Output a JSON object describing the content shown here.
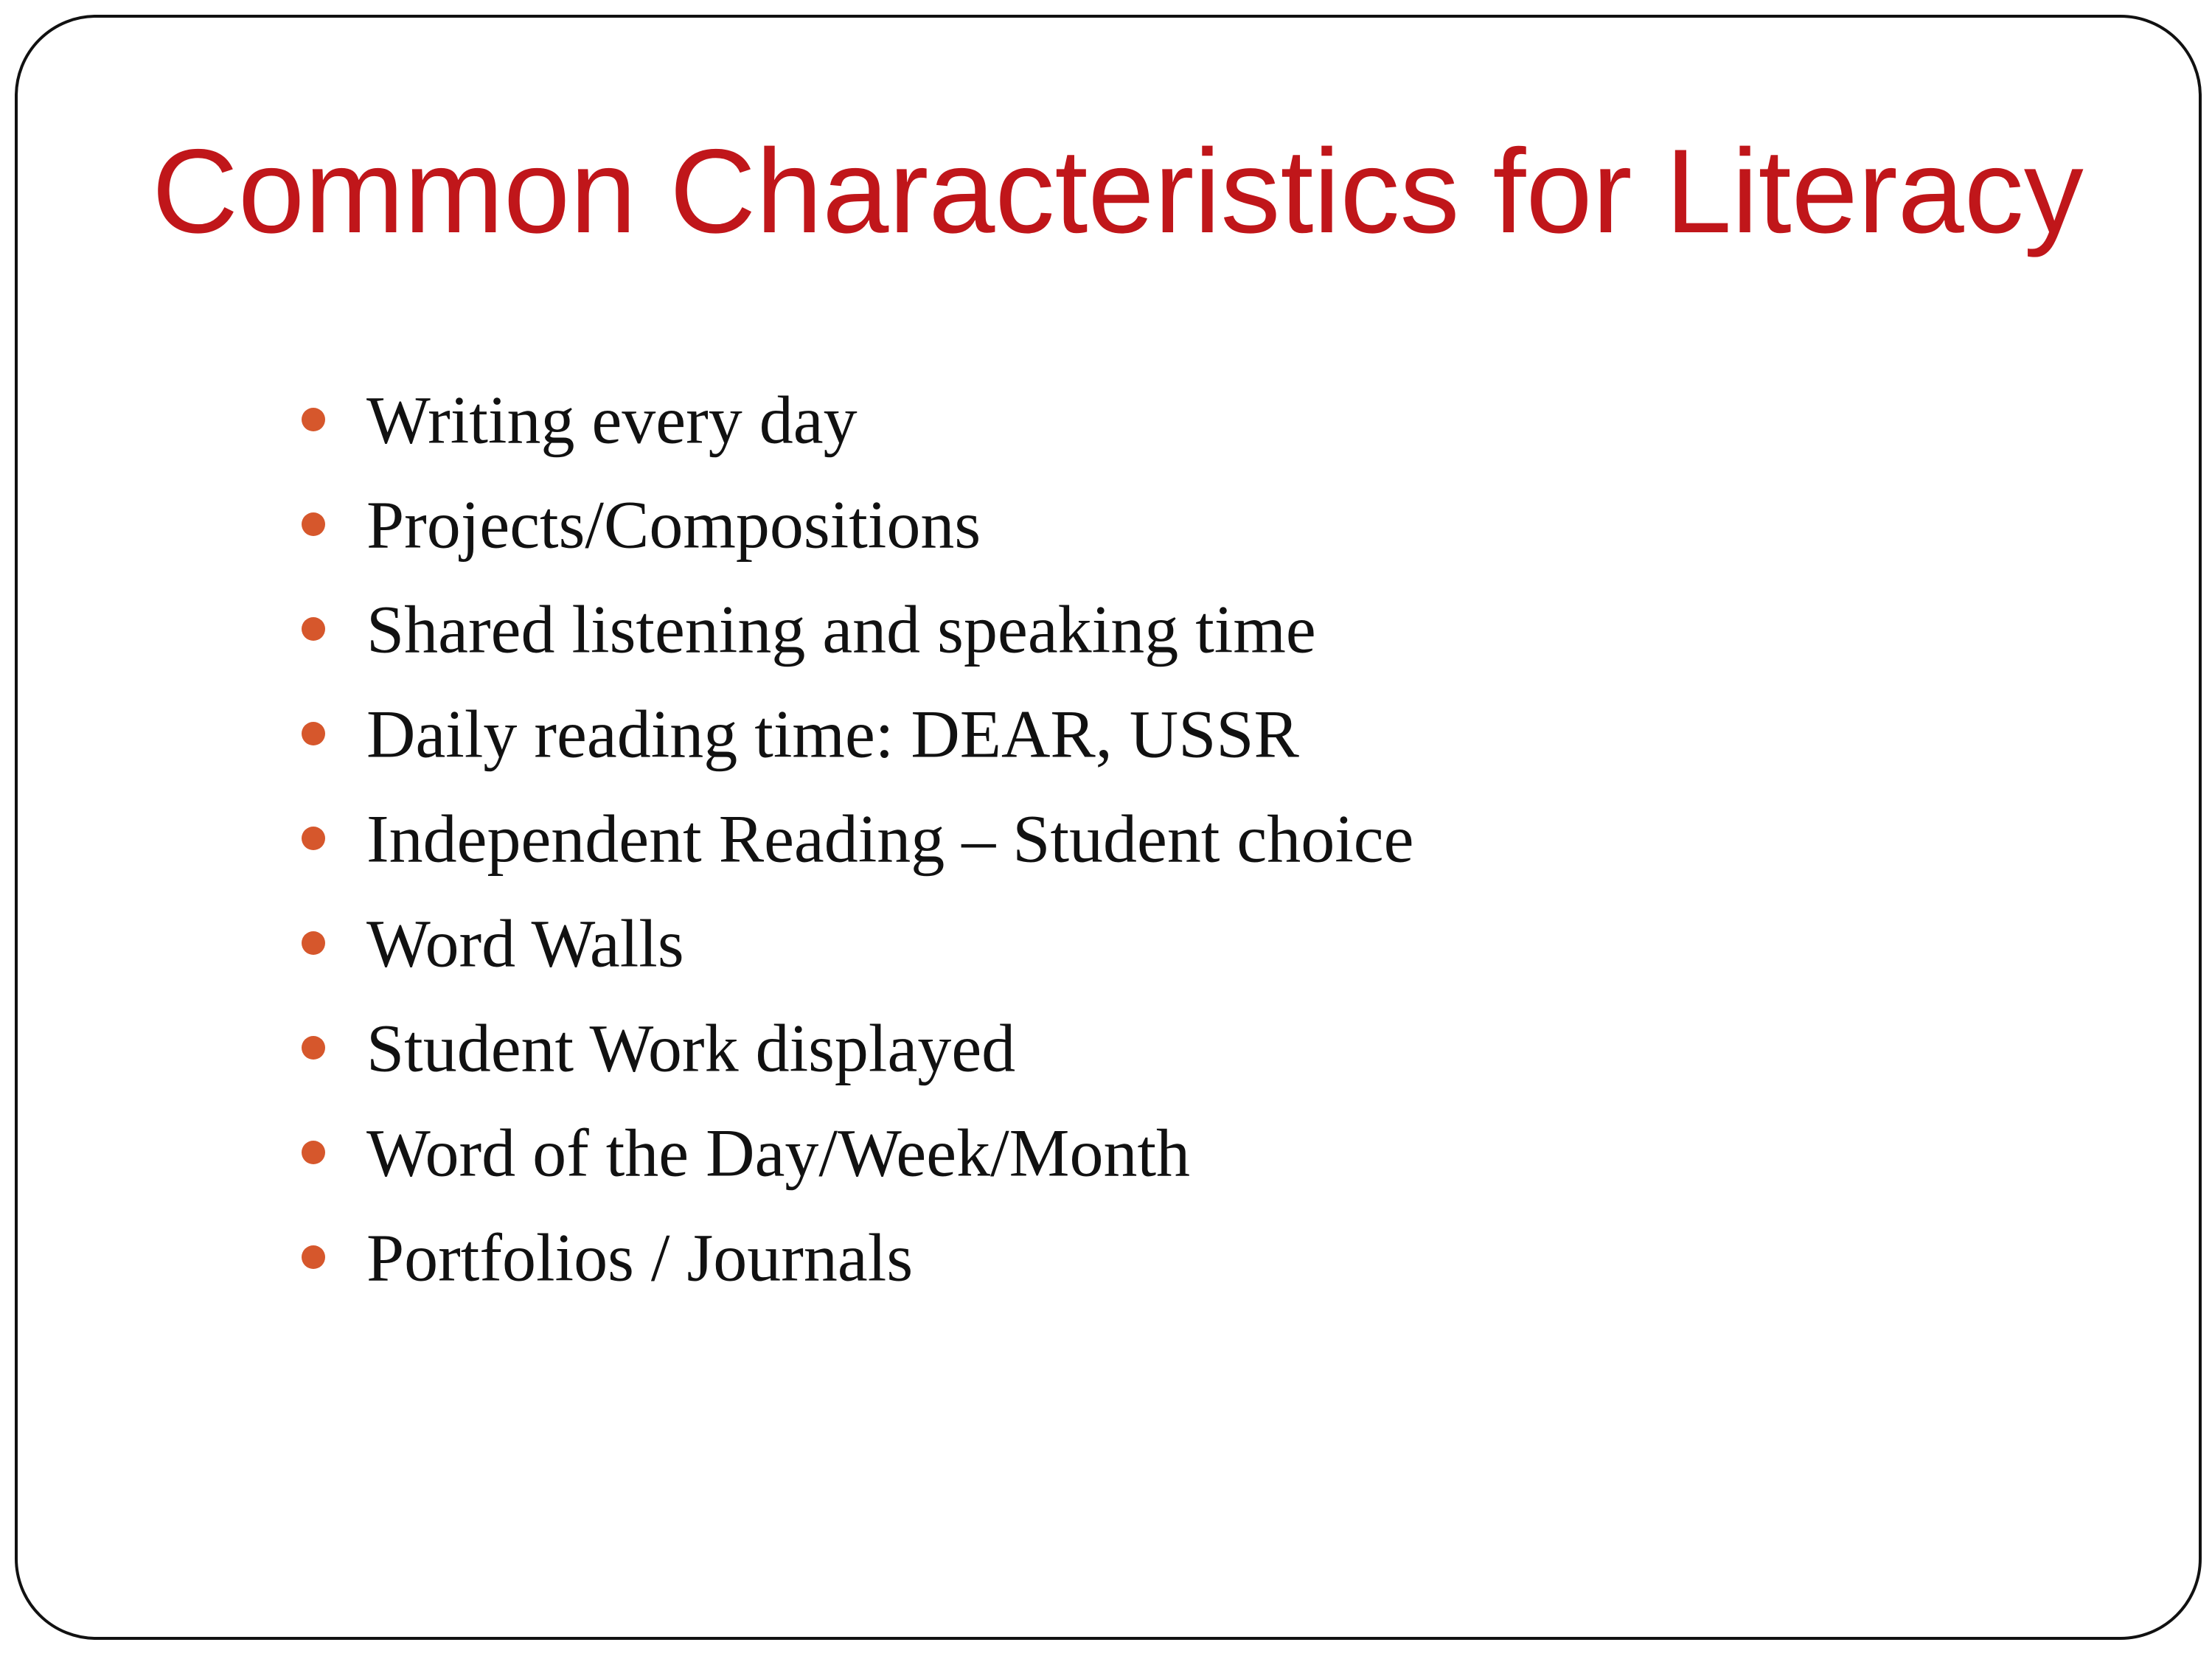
{
  "slide": {
    "title": "Common Characteristics for Literacy",
    "title_color": "#c0161a",
    "bullet_color": "#d6572c",
    "items": [
      "Writing every day",
      "Projects/Compositions",
      "Shared listening and speaking time",
      "Daily reading time:  DEAR, USSR",
      "Independent Reading – Student choice",
      "Word Walls",
      "Student Work displayed",
      "Word of the Day/Week/Month",
      "Portfolios / Journals"
    ]
  }
}
